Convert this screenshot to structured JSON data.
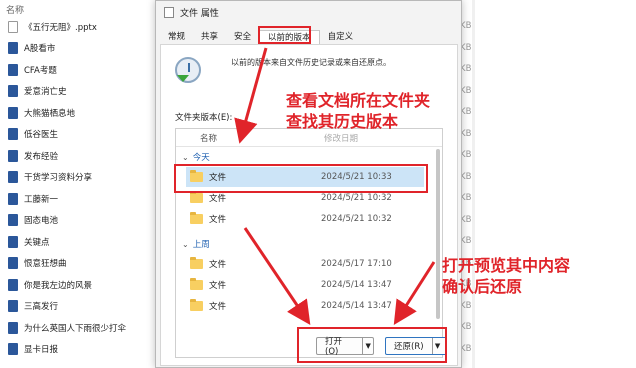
{
  "explorer": {
    "header": "名称",
    "files": [
      {
        "name": "《五行无阻》.pptx",
        "icon": "pptx-file-icon"
      },
      {
        "name": "A股看市",
        "icon": "word-file-icon"
      },
      {
        "name": "CFA考题",
        "icon": "word-file-icon"
      },
      {
        "name": "爱意消亡史",
        "icon": "word-file-icon"
      },
      {
        "name": "大熊猫栖息地",
        "icon": "word-file-icon"
      },
      {
        "name": "低谷医生",
        "icon": "word-file-icon"
      },
      {
        "name": "发布经验",
        "icon": "word-file-icon"
      },
      {
        "name": "干货学习资料分享",
        "icon": "word-file-icon"
      },
      {
        "name": "工藤新一",
        "icon": "word-file-icon"
      },
      {
        "name": "固态电池",
        "icon": "word-file-icon"
      },
      {
        "name": "关键点",
        "icon": "word-file-icon"
      },
      {
        "name": "恨意狂想曲",
        "icon": "word-file-icon"
      },
      {
        "name": "你是我左边的风景",
        "icon": "word-file-icon"
      },
      {
        "name": "三高发行",
        "icon": "word-file-icon"
      },
      {
        "name": "为什么英国人下雨很少打伞",
        "icon": "word-file-icon"
      },
      {
        "name": "显卡日报",
        "icon": "word-file-icon"
      }
    ],
    "size_unit": "KB"
  },
  "dialog": {
    "title": "文件 属性",
    "tabs": [
      "常规",
      "共享",
      "安全",
      "以前的版本",
      "自定义"
    ],
    "active_tab": "以前的版本",
    "description": "以前的版本来自文件历史记录或来自还原点。",
    "folder_versions_label": "文件夹版本(E):",
    "columns": {
      "name": "名称",
      "date": "修改日期"
    },
    "groups": [
      {
        "label": "今天",
        "rows": [
          {
            "name": "文件",
            "date": "2024/5/21 10:33",
            "selected": true
          },
          {
            "name": "文件",
            "date": "2024/5/21 10:32",
            "selected": false
          },
          {
            "name": "文件",
            "date": "2024/5/21 10:32",
            "selected": false
          }
        ]
      },
      {
        "label": "上周",
        "rows": [
          {
            "name": "文件",
            "date": "2024/5/17 17:10",
            "selected": false
          },
          {
            "name": "文件",
            "date": "2024/5/14 13:47",
            "selected": false
          },
          {
            "name": "文件",
            "date": "2024/5/14 13:47",
            "selected": false
          }
        ]
      }
    ],
    "open_button": "打开(O)",
    "restore_button": "还原(R)"
  },
  "annotations": {
    "note1_line1": "查看文档所在文件夹",
    "note1_line2": "查找其历史版本",
    "note2_line1": "打开预览其中内容",
    "note2_line2": "确认后还原",
    "color": "#e0242a"
  }
}
